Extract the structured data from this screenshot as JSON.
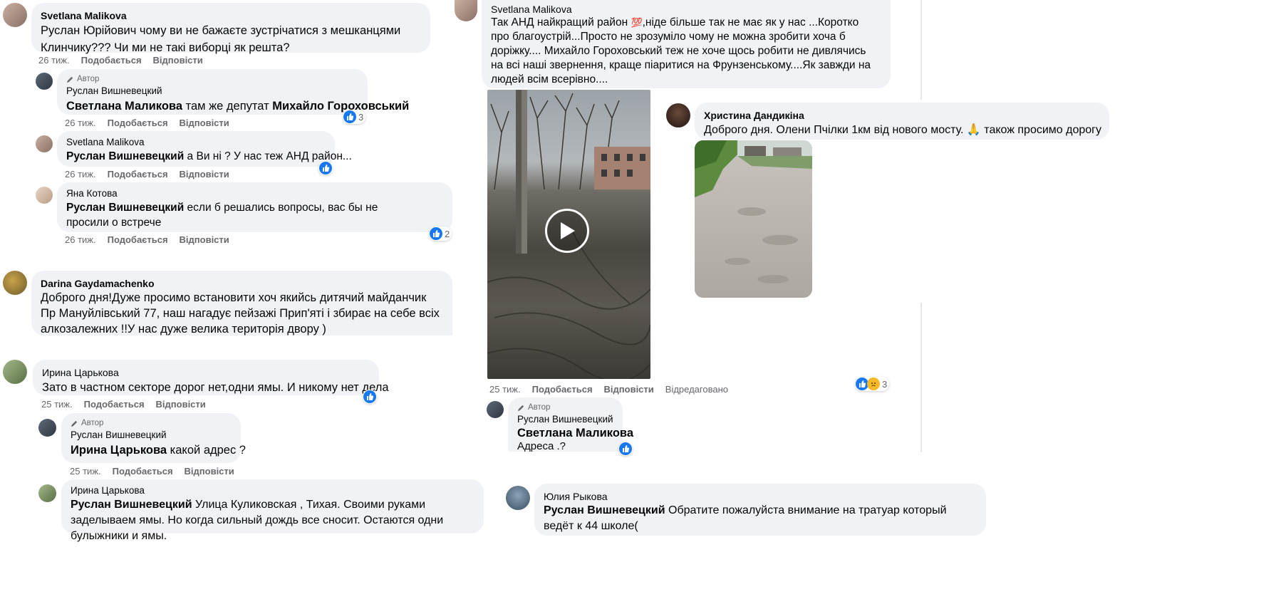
{
  "comments": {
    "c1": {
      "author": "Svetlana Malikova",
      "text": "Руслан Юрійович чому ви не бажаєте зустрічатися з мешканцями Клинчику??? Чи ми не такі виборці як решта?",
      "time": "26 тиж.",
      "like": "Подобається",
      "reply": "Відповісти"
    },
    "c2": {
      "author_tag": "Автор",
      "author": "Руслан Вишневецкий",
      "mention": "Светлана Маликова",
      "text": " там же депутат ",
      "mention2": "Михайло Гороховський",
      "reactions": "3",
      "time": "26 тиж.",
      "like": "Подобається",
      "reply": "Відповісти"
    },
    "c3": {
      "author": "Svetlana Malikova",
      "mention": "Руслан Вишневецкий",
      "text": " а Ви ні ? У нас теж АНД район...",
      "time": "26 тиж.",
      "like": "Подобається",
      "reply": "Відповісти"
    },
    "c4": {
      "author": "Яна Котова",
      "mention": "Руслан Вишневецкий",
      "text": " если б решались вопросы, вас бы не просили о встрече",
      "reactions": "2",
      "time": "26 тиж.",
      "like": "Подобається",
      "reply": "Відповісти"
    },
    "c5": {
      "author": "Darina Gaydamachenko",
      "text": "Доброго дня!Дуже просимо встановити хоч якийсь дитячий майданчик Пр Мануйлівський 77, наш нагадує пейзажі Прип'яті і збирає на себе всіх алкозалежних !!У нас дуже велика територія двору )"
    },
    "c6": {
      "author": "Ирина Царькова",
      "text": "Зато в частном секторе дорог нет,одни ямы. И никому нет дела",
      "time": "25 тиж.",
      "like": "Подобається",
      "reply": "Відповісти"
    },
    "c7": {
      "author_tag": "Автор",
      "author": "Руслан Вишневецкий",
      "mention": "Ирина Царькова",
      "text": " какой адрес ?",
      "time": "25 тиж.",
      "like": "Подобається",
      "reply": "Відповісти"
    },
    "c8": {
      "author": "Ирина Царькова",
      "mention": "Руслан Вишневецкий",
      "text": " Улица Куликовская , Тихая. Своими руками заделываем ямы. Но когда сильный дождь все сносит. Остаются одни булыжники и ямы."
    },
    "c9": {
      "author": "Svetlana Malikova",
      "text_before": "Так АНД найкращий район ",
      "emoji": "💯",
      "text_after": ",ніде більше так не має як у нас ...Коротко про благоустрій...Просто не зрозуміло чому не можна зробити хоча б доріжку.... Михайло Гороховський теж не хоче щось робити не дивлячись на всі наші звернення, краще піаритися на Фрунзенському....Як завжди на людей всім всерівно....",
      "reactions": "3",
      "time": "25 тиж.",
      "like": "Подобається",
      "reply": "Відповісти",
      "edited": "Відредаговано"
    },
    "c10": {
      "author": "Христина Дандикіна",
      "text_before": "Доброго дня. Олени Пчілки 1км від нового мосту. ",
      "emoji": "🙏",
      "text_after": " також просимо дорогу"
    },
    "c11": {
      "author_tag": "Автор",
      "author": "Руслан Вишневецкий",
      "mention": "Светлана Маликова",
      "text": "Адреса .?"
    },
    "c12": {
      "author": "Юлия Рыкова",
      "mention": "Руслан Вишневецкий",
      "text": " Обратите пожалуйста внимание на тратуар который ведёт к 44 школе("
    }
  },
  "icons": {
    "like": "thumbs-up-icon",
    "sad": "sad-face-icon",
    "play": "play-icon",
    "author": "pencil-icon"
  },
  "colors": {
    "like_blue": "#1877f2",
    "bubble": "#f0f2f5",
    "meta_gray": "#65676b"
  }
}
